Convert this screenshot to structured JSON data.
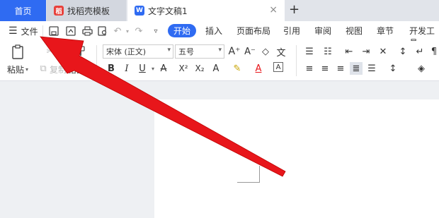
{
  "tabs": {
    "home": "首页",
    "templates": "找稻壳模板",
    "document": "文字文稿1",
    "close_symbol": "×",
    "add_symbol": "+"
  },
  "menubar": {
    "file_label": "文件",
    "ribbon_tabs": [
      "开始",
      "插入",
      "页面布局",
      "引用",
      "审阅",
      "视图",
      "章节",
      "开发工具"
    ]
  },
  "ribbon": {
    "paste_label": "粘贴",
    "format_painter_label": "格式刷",
    "copy_label": "复制",
    "font_name": "宋体 (正文)",
    "font_size": "五号"
  },
  "colors": {
    "accent": "#2f6bf2",
    "arrow": "#e8161b",
    "template_icon": "#e8413b"
  }
}
